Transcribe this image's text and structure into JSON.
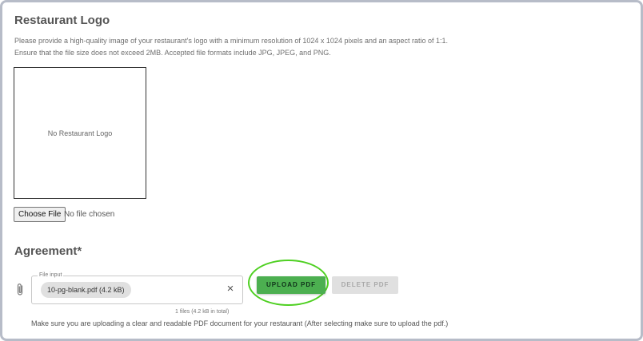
{
  "restaurant_logo": {
    "title": "Restaurant Logo",
    "description_line1": "Please provide a high-quality image of your restaurant's logo with a minimum resolution of 1024 x 1024 pixels and an aspect ratio of 1:1.",
    "description_line2": "Ensure that the file size does not exceed 2MB. Accepted file formats include JPG, JPEG, and PNG.",
    "placeholder": "No Restaurant Logo",
    "choose_file_label": "Choose File",
    "file_status": "No file chosen"
  },
  "agreement": {
    "title": "Agreement*",
    "file_input_label": "File input",
    "file_chip": "10-pg-blank.pdf (4.2 kB)",
    "clear_symbol": "×",
    "file_count": "1 files (4.2 kB in total)",
    "upload_label": "UPLOAD PDF",
    "delete_label": "DELETE PDF",
    "note": "Make sure you are uploading a clear and readable PDF document for your restaurant (After selecting make sure to upload the pdf.)"
  },
  "colors": {
    "upload_button": "#4caf50",
    "highlight_ring": "#4ed021",
    "frame_border": "#b7bcc8"
  },
  "icons": {
    "attachment": "paperclip-icon",
    "clear": "close-icon"
  }
}
